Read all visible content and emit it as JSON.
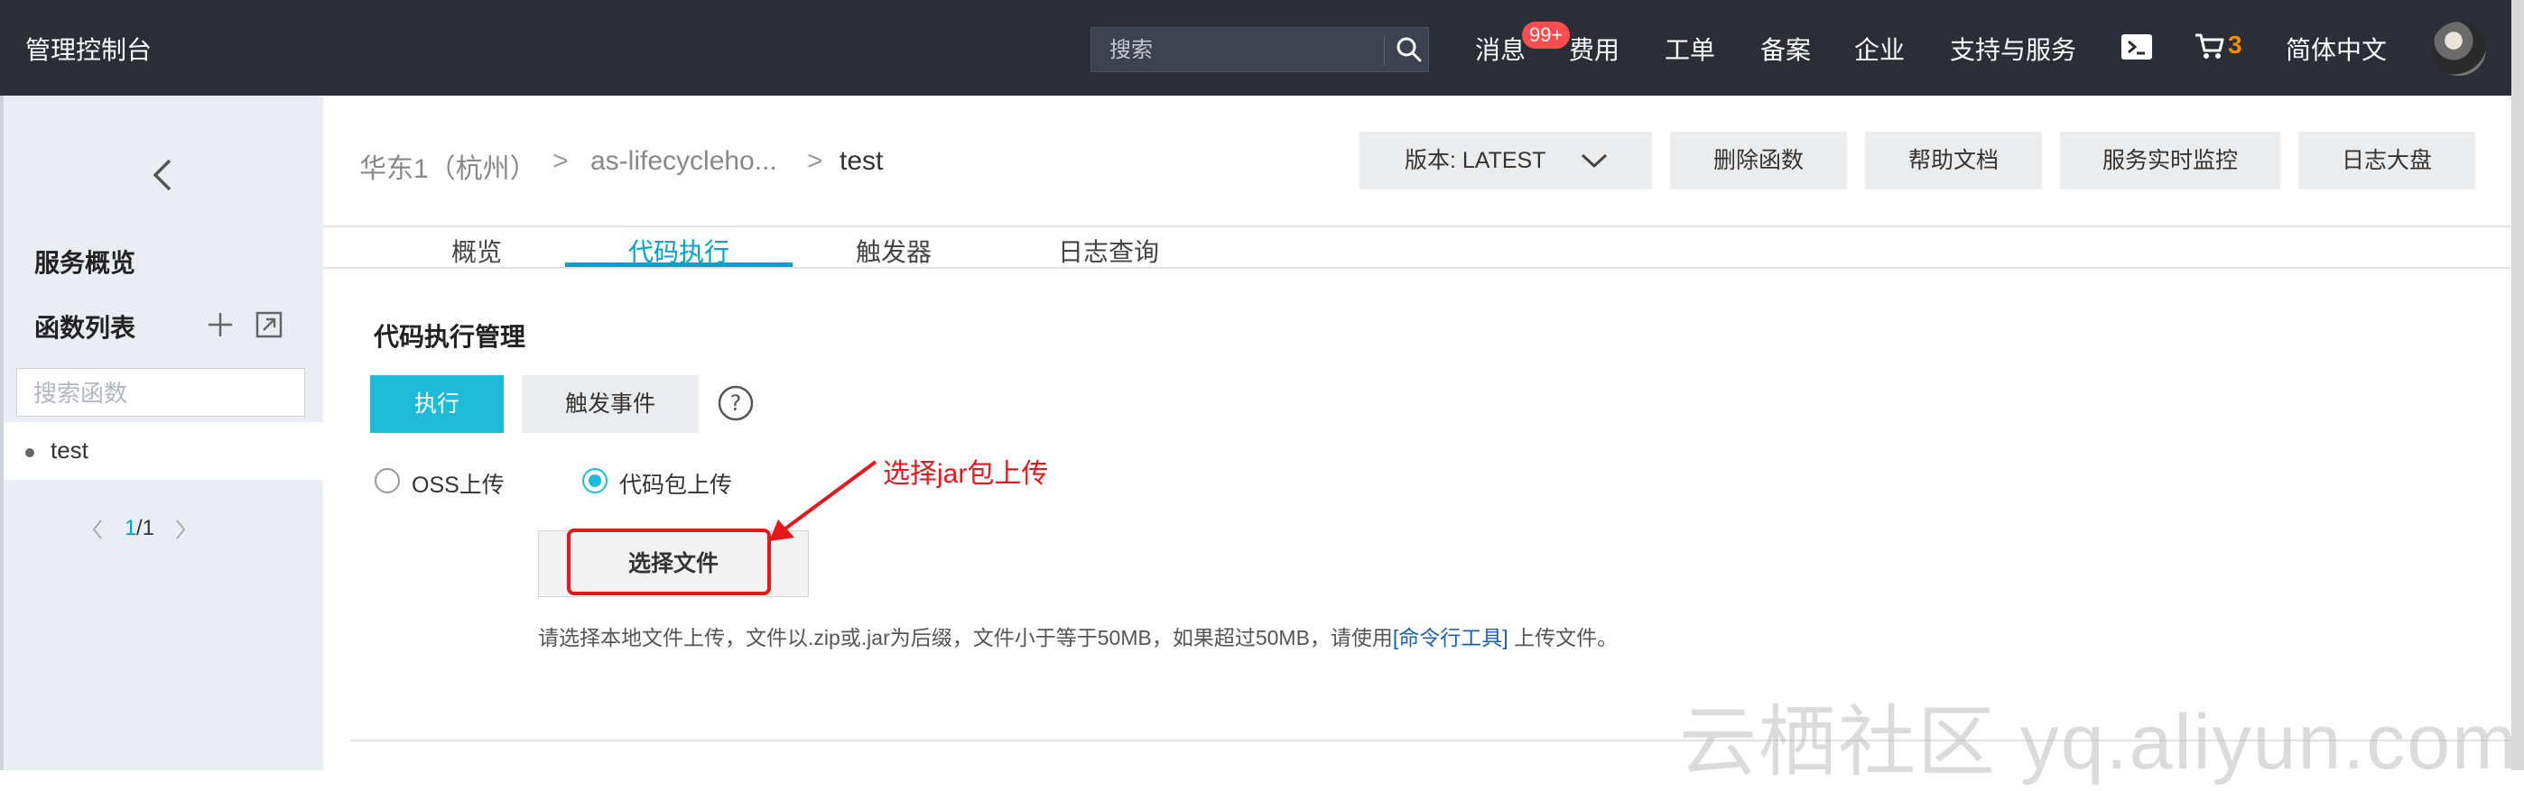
{
  "topbar": {
    "brand": "管理控制台",
    "search_placeholder": "搜索",
    "nav": {
      "messages": "消息",
      "messages_badge": "99+",
      "billing": "费用",
      "tickets": "工单",
      "icp": "备案",
      "enterprise": "企业",
      "support": "支持与服务",
      "cart_count": "3",
      "language": "简体中文"
    }
  },
  "sidebar": {
    "service_overview": "服务概览",
    "function_list": "函数列表",
    "search_placeholder": "搜索函数",
    "items": [
      {
        "label": "test"
      }
    ],
    "pager": {
      "current": "1",
      "total": "/1"
    }
  },
  "header": {
    "breadcrumb": {
      "region": "华东1（杭州）",
      "service": "as-lifecycleho...",
      "function": "test",
      "sep": ">"
    },
    "buttons": {
      "version": "版本: LATEST",
      "delete": "删除函数",
      "help_docs": "帮助文档",
      "monitor": "服务实时监控",
      "log_dashboard": "日志大盘"
    }
  },
  "tabs": [
    {
      "label": "概览"
    },
    {
      "label": "代码执行"
    },
    {
      "label": "触发器"
    },
    {
      "label": "日志查询"
    }
  ],
  "content": {
    "section_title": "代码执行管理",
    "execute_button": "执行",
    "trigger_event_button": "触发事件",
    "upload_options": [
      {
        "label": "OSS上传",
        "selected": false
      },
      {
        "label": "代码包上传",
        "selected": true
      }
    ],
    "choose_file_button": "选择文件",
    "annotation": "选择jar包上传",
    "hint_prefix": "请选择本地文件上传，文件以.zip或.jar为后缀，文件小于等于50MB，如果超过50MB，请使用",
    "hint_link": "[命令行工具]",
    "hint_suffix": " 上传文件。"
  },
  "watermark": "云栖社区 yq.aliyun.com",
  "colors": {
    "topbar_bg": "#2b2e37",
    "accent": "#00a2ca",
    "primary_button": "#1ebbd8",
    "annotation_red": "#e8171c",
    "badge_red": "#ff4d4f",
    "cart_orange": "#ff8a00"
  }
}
